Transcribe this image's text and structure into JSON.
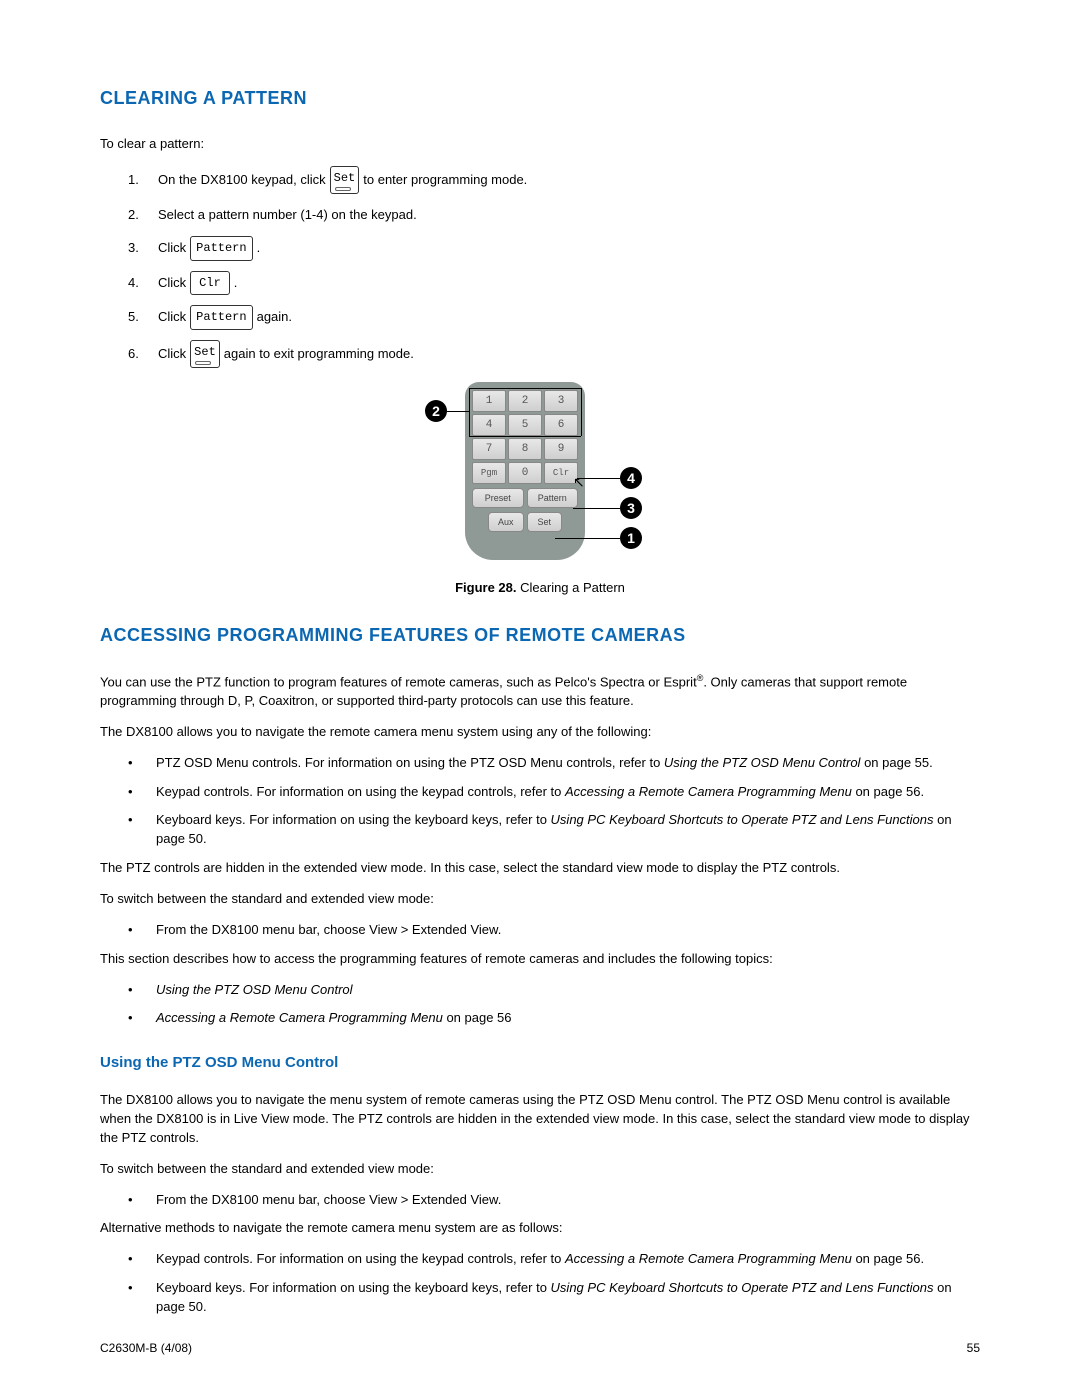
{
  "headings": {
    "clearing": "CLEARING A PATTERN",
    "accessing": "ACCESSING PROGRAMMING FEATURES OF REMOTE CAMERAS",
    "osd": "Using the PTZ OSD Menu Control"
  },
  "clearing": {
    "intro": "To clear a pattern:",
    "s1a": "On the DX8100 keypad, click",
    "s1b": "to enter programming mode.",
    "s2": "Select a pattern number (1-4) on the keypad.",
    "s3": "Click",
    "s4": "Click",
    "s5a": "Click",
    "s5b": "again.",
    "s6a": "Click",
    "s6b": "again to exit programming mode."
  },
  "buttons": {
    "set": "Set",
    "pattern": "Pattern",
    "clr": "Clr"
  },
  "figure": {
    "label": "Figure 28.",
    "caption": "Clearing a Pattern",
    "keys": {
      "k1": "1",
      "k2": "2",
      "k3": "3",
      "k4": "4",
      "k5": "5",
      "k6": "6",
      "k7": "7",
      "k8": "8",
      "k9": "9",
      "pgm": "Pgm",
      "k0": "0",
      "clr": "Clr",
      "preset": "Preset",
      "pattern": "Pattern",
      "aux": "Aux",
      "set": "Set"
    },
    "callouts": {
      "c1": "1",
      "c2": "2",
      "c3": "3",
      "c4": "4"
    }
  },
  "accessing": {
    "p1a": "You can use the PTZ function to program features of remote cameras, such as Pelco's Spectra or Esprit",
    "p1b": ". Only cameras that support remote programming through D, P, Coaxitron, or supported third-party protocols can use this feature.",
    "p2": "The DX8100 allows you to navigate the remote camera menu system using any of the following:",
    "b1a": "PTZ OSD Menu controls. For information on using the PTZ OSD Menu controls, refer to ",
    "b1i": "Using the PTZ OSD Menu Control",
    "b1c": " on page 55.",
    "b2a": "Keypad controls. For information on using the keypad controls, refer to ",
    "b2i": "Accessing a Remote Camera Programming Menu",
    "b2c": " on page 56.",
    "b3a": "Keyboard keys. For information on using the keyboard keys, refer to ",
    "b3i": "Using PC Keyboard Shortcuts to Operate PTZ and Lens Functions",
    "b3c": " on page 50.",
    "p3": "The PTZ controls are hidden in the extended view mode. In this case, select the standard view mode to display the PTZ controls.",
    "p4": "To switch between the standard and extended view mode:",
    "b4": "From the DX8100 menu bar, choose View > Extended View.",
    "p5": "This section describes how to access the programming features of remote cameras and includes the following topics:",
    "t1": "Using the PTZ OSD Menu Control",
    "t2a": "Accessing a Remote Camera Programming Menu",
    "t2b": " on page 56"
  },
  "osd": {
    "p1": "The DX8100 allows you to navigate the menu system of remote cameras using the PTZ OSD Menu control. The PTZ OSD Menu control is available when the DX8100 is in Live View mode. The PTZ controls are hidden in the extended view mode. In this case, select the standard view mode to display the PTZ controls.",
    "p2": "To switch between the standard and extended view mode:",
    "b1": "From the DX8100 menu bar, choose View > Extended View.",
    "p3": "Alternative methods to navigate the remote camera menu system are as follows:",
    "b2a": "Keypad controls. For information on using the keypad controls, refer to ",
    "b2i": "Accessing a Remote Camera Programming Menu",
    "b2c": " on page 56.",
    "b3a": "Keyboard keys. For information on using the keyboard keys, refer to ",
    "b3i": "Using PC Keyboard Shortcuts to Operate PTZ and Lens Functions",
    "b3c": " on page 50."
  },
  "footer": {
    "left": "C2630M-B (4/08)",
    "right": "55"
  }
}
